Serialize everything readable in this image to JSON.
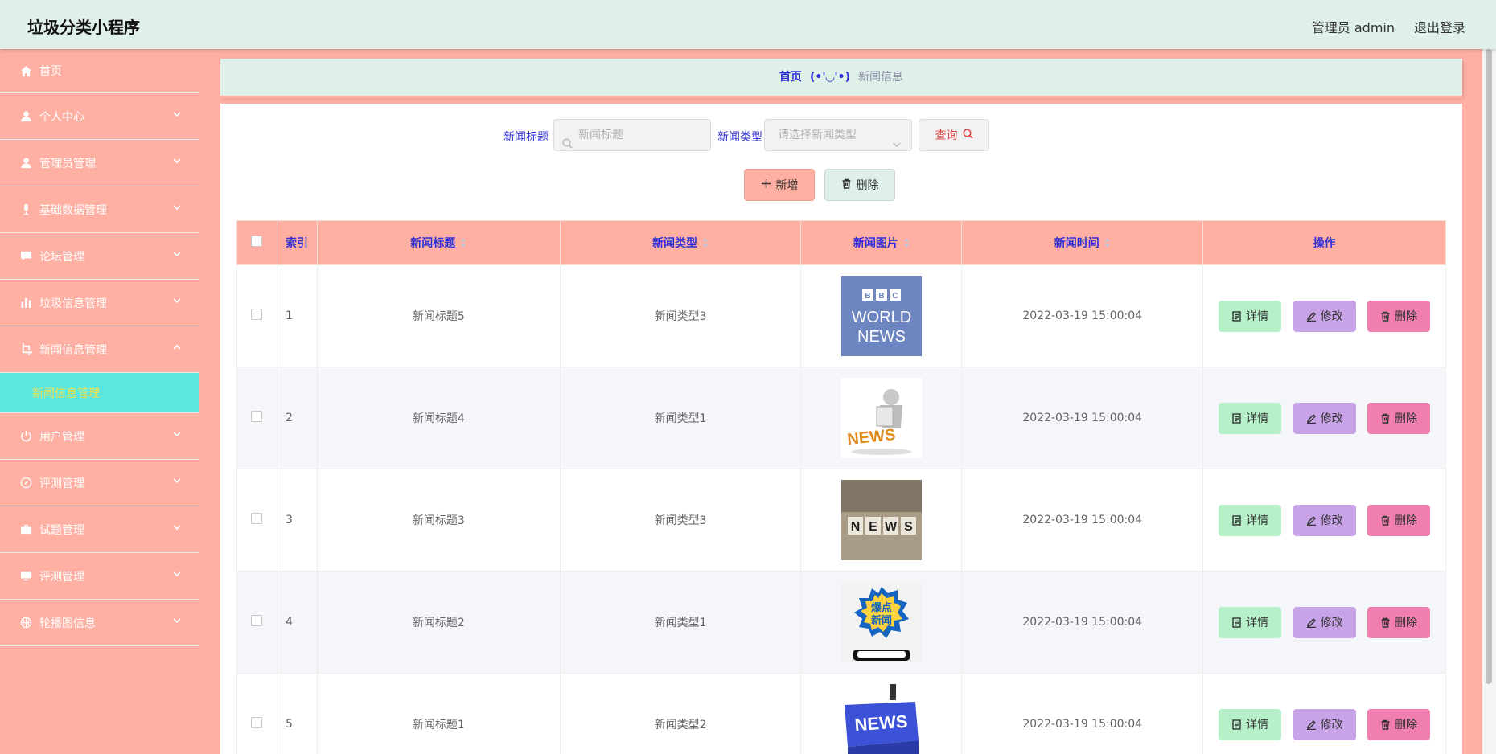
{
  "header": {
    "title": "垃圾分类小程序",
    "admin": "管理员 admin",
    "logout": "退出登录"
  },
  "sidebar": {
    "items": [
      {
        "label": "首页",
        "icon": "home-icon"
      },
      {
        "label": "个人中心",
        "icon": "user-icon"
      },
      {
        "label": "管理员管理",
        "icon": "user-icon"
      },
      {
        "label": "基础数据管理",
        "icon": "mic-icon"
      },
      {
        "label": "论坛管理",
        "icon": "chat-icon"
      },
      {
        "label": "垃圾信息管理",
        "icon": "bar-chart-icon"
      },
      {
        "label": "新闻信息管理",
        "icon": "crop-icon"
      },
      {
        "label": "用户管理",
        "icon": "power-icon"
      },
      {
        "label": "评测管理",
        "icon": "compass-icon"
      },
      {
        "label": "试题管理",
        "icon": "briefcase-icon"
      },
      {
        "label": "评测管理",
        "icon": "monitor-icon"
      },
      {
        "label": "轮播图信息",
        "icon": "basketball-icon"
      }
    ],
    "active_sub": "新闻信息管理"
  },
  "breadcrumb": {
    "home": "首页",
    "separator": "(•'◡'•)",
    "current": "新闻信息"
  },
  "search": {
    "title_label": "新闻标题",
    "title_placeholder": "新闻标题",
    "type_label": "新闻类型",
    "type_placeholder": "请选择新闻类型",
    "query_label": "查询"
  },
  "actions": {
    "add_label": "新增",
    "delete_label": "删除"
  },
  "table": {
    "columns": [
      "索引",
      "新闻标题",
      "新闻类型",
      "新闻图片",
      "新闻时间",
      "操作"
    ],
    "row_actions": {
      "detail": "详情",
      "edit": "修改",
      "delete": "删除"
    },
    "rows": [
      {
        "index": "1",
        "title": "新闻标题5",
        "type": "新闻类型3",
        "time": "2022-03-19 15:00:04",
        "image": "BBC WORLD NEWS"
      },
      {
        "index": "2",
        "title": "新闻标题4",
        "type": "新闻类型1",
        "time": "2022-03-19 15:00:04",
        "image": "NEWS"
      },
      {
        "index": "3",
        "title": "新闻标题3",
        "type": "新闻类型3",
        "time": "2022-03-19 15:00:04",
        "image": "NEWS"
      },
      {
        "index": "4",
        "title": "新闻标题2",
        "type": "新闻类型1",
        "time": "2022-03-19 15:00:04",
        "image": "爆点新闻"
      },
      {
        "index": "5",
        "title": "新闻标题1",
        "type": "新闻类型2",
        "time": "2022-03-19 15:00:04",
        "image": "NEWS"
      }
    ]
  },
  "colors": {
    "sidebar": "#ffb0a3",
    "header": "#dff0e8",
    "accent": "#2e2fd6",
    "submenu": "#5ce6de"
  }
}
